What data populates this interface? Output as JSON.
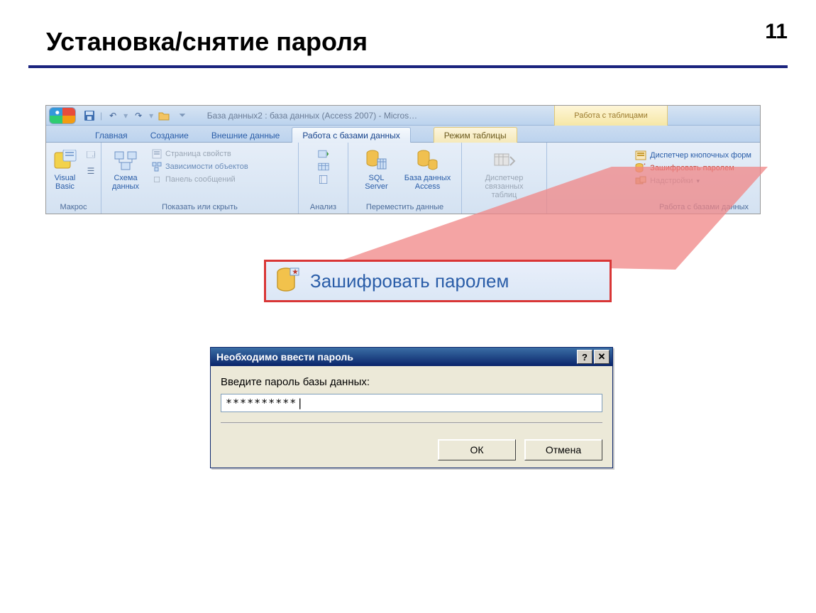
{
  "slide": {
    "title": "Установка/снятие пароля",
    "number": "11"
  },
  "titlebar": {
    "text": "База данных2 : база данных (Access 2007) - Micros…",
    "contextual": "Работа с таблицами"
  },
  "tabs": {
    "home": "Главная",
    "create": "Создание",
    "external": "Внешние данные",
    "dbtools": "Работа с базами данных",
    "datasheet": "Режим таблицы"
  },
  "groups": {
    "macro": {
      "vb": "Visual\nBasic",
      "label": "Макрос"
    },
    "show": {
      "schema": "Схема\nданных",
      "props": "Страница свойств",
      "deps": "Зависимости объектов",
      "msgbar": "Панель сообщений",
      "label": "Показать или скрыть"
    },
    "analyze": {
      "label": "Анализ"
    },
    "move": {
      "sql": "SQL\nServer",
      "access": "База данных\nAccess",
      "label": "Переместить данные"
    },
    "linked": {
      "name": "Диспетчер\nсвязанных таблиц"
    },
    "tools": {
      "switchboard": "Диспетчер кнопочных форм",
      "encrypt": "Зашифровать паролем",
      "addins": "Надстройки",
      "label": "Работа с базами данных"
    }
  },
  "callout": {
    "text": "Зашифровать паролем"
  },
  "dialog": {
    "title": "Необходимо ввести пароль",
    "label": "Введите пароль базы данных:",
    "value": "**********|",
    "ok": "ОК",
    "cancel": "Отмена"
  },
  "icons": {
    "save": "save-icon",
    "undo": "undo-icon",
    "redo": "redo-icon",
    "folder": "folder-icon",
    "help": "help-icon",
    "close": "close-icon"
  }
}
